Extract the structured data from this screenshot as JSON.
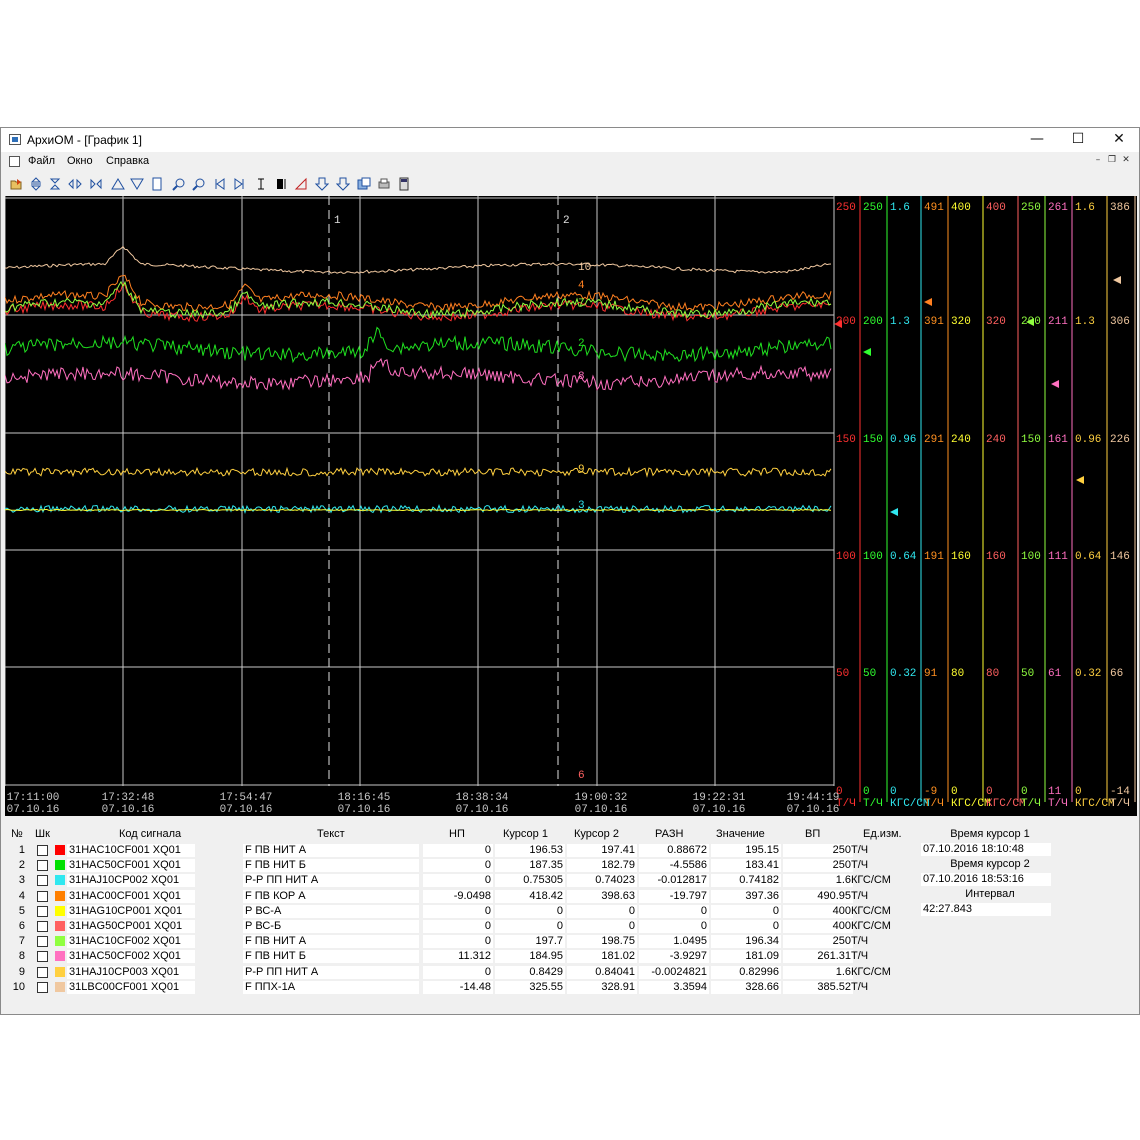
{
  "window": {
    "title": "АрхиОМ - [График 1]",
    "menu": [
      "Файл",
      "Окно",
      "Справка"
    ]
  },
  "toolbar_icons": [
    "open-icon",
    "expand-vertical-icon",
    "collapse-vertical-icon",
    "split-icon",
    "join-icon",
    "triangle-up-icon",
    "triangle-down-icon",
    "page-icon",
    "zoom-in-icon",
    "zoom-out-icon",
    "first-icon",
    "last-icon",
    "cursor-icon",
    "bracket-icon",
    "angle-icon",
    "arrow-down-icon",
    "arrow-down2-icon",
    "export-icon",
    "print-icon",
    "calculator-icon"
  ],
  "chart": {
    "cursor1_label": "1",
    "cursor2_label": "2",
    "time_ticks": [
      {
        "time": "17:11:00",
        "date": "07.10.16"
      },
      {
        "time": "17:32:48",
        "date": "07.10.16"
      },
      {
        "time": "17:54:47",
        "date": "07.10.16"
      },
      {
        "time": "18:16:45",
        "date": "07.10.16"
      },
      {
        "time": "18:38:34",
        "date": "07.10.16"
      },
      {
        "time": "19:00:32",
        "date": "07.10.16"
      },
      {
        "time": "19:22:31",
        "date": "07.10.16"
      },
      {
        "time": "19:44:19",
        "date": "07.10.16"
      }
    ],
    "scales": [
      {
        "color": "#ff3030",
        "labels": [
          "250",
          "200",
          "150",
          "100",
          "50",
          "0"
        ],
        "unit": "Т/Ч"
      },
      {
        "color": "#30ff30",
        "labels": [
          "250",
          "200",
          "150",
          "100",
          "50",
          "0"
        ],
        "unit": "Т/Ч"
      },
      {
        "color": "#30e8f0",
        "labels": [
          "1.6",
          "1.3",
          "0.96",
          "0.64",
          "0.32",
          "0"
        ],
        "unit": "КГС/СМ"
      },
      {
        "color": "#ff9020",
        "labels": [
          "491",
          "391",
          "291",
          "191",
          "91",
          "-9"
        ],
        "unit": "Т/Ч"
      },
      {
        "color": "#ffff30",
        "labels": [
          "400",
          "320",
          "240",
          "160",
          "80",
          "0"
        ],
        "unit": "КГС/СМ"
      },
      {
        "color": "#ff6060",
        "labels": [
          "400",
          "320",
          "240",
          "160",
          "80",
          "0"
        ],
        "unit": "КГС/СМ"
      },
      {
        "color": "#90ff40",
        "labels": [
          "250",
          "200",
          "150",
          "100",
          "50",
          "0"
        ],
        "unit": "Т/Ч"
      },
      {
        "color": "#ff70c0",
        "labels": [
          "261",
          "211",
          "161",
          "111",
          "61",
          "11"
        ],
        "unit": "Т/Ч"
      },
      {
        "color": "#ffd040",
        "labels": [
          "1.6",
          "1.3",
          "0.96",
          "0.64",
          "0.32",
          "0"
        ],
        "unit": "КГС/СМ"
      },
      {
        "color": "#f0c8a0",
        "labels": [
          "386",
          "306",
          "226",
          "146",
          "66",
          "-14"
        ],
        "unit": "Т/Ч"
      }
    ],
    "trace_labels": [
      "10",
      "4",
      "7",
      "2",
      "8",
      "9",
      "3",
      "6"
    ]
  },
  "table": {
    "headers": {
      "num": "№",
      "shk": "Шк",
      "code": "Код сигнала",
      "text": "Текст",
      "np": "НП",
      "c1": "Курсор 1",
      "c2": "Курсор 2",
      "diff": "РАЗН",
      "value": "Значение",
      "vp": "ВП",
      "unit": "Ед.изм."
    },
    "rows": [
      {
        "n": "1",
        "color": "#ff0000",
        "code": "31HAC10CF001 XQ01",
        "text": "F ПВ НИТ А",
        "np": "0",
        "c1": "196.53",
        "c2": "197.41",
        "diff": "0.88672",
        "value": "195.15",
        "vp": "250",
        "unit": "Т/Ч"
      },
      {
        "n": "2",
        "color": "#00e000",
        "code": "31HAC50CF001 XQ01",
        "text": "F ПВ НИТ Б",
        "np": "0",
        "c1": "187.35",
        "c2": "182.79",
        "diff": "-4.5586",
        "value": "183.41",
        "vp": "250",
        "unit": "Т/Ч"
      },
      {
        "n": "3",
        "color": "#30e8f0",
        "code": "31HAJ10CP002 XQ01",
        "text": "Р-Р ПП НИТ А",
        "np": "0",
        "c1": "0.75305",
        "c2": "0.74023",
        "diff": "-0.012817",
        "value": "0.74182",
        "vp": "1.6",
        "unit": "КГС/СМ"
      },
      {
        "n": "4",
        "color": "#ff8000",
        "code": "31HAC00CF001 XQ01",
        "text": "F ПВ КОР А",
        "np": "-9.0498",
        "c1": "418.42",
        "c2": "398.63",
        "diff": "-19.797",
        "value": "397.36",
        "vp": "490.95",
        "unit": "Т/Ч"
      },
      {
        "n": "5",
        "color": "#ffff00",
        "code": "31HAG10CP001 XQ01",
        "text": "Р ВС-А",
        "np": "0",
        "c1": "0",
        "c2": "0",
        "diff": "0",
        "value": "0",
        "vp": "400",
        "unit": "КГС/СМ"
      },
      {
        "n": "6",
        "color": "#ff6060",
        "code": "31HAG50CP001 XQ01",
        "text": "Р ВС-Б",
        "np": "0",
        "c1": "0",
        "c2": "0",
        "diff": "0",
        "value": "0",
        "vp": "400",
        "unit": "КГС/СМ"
      },
      {
        "n": "7",
        "color": "#90ff40",
        "code": "31HAC10CF002 XQ01",
        "text": "F ПВ НИТ А",
        "np": "0",
        "c1": "197.7",
        "c2": "198.75",
        "diff": "1.0495",
        "value": "196.34",
        "vp": "250",
        "unit": "Т/Ч"
      },
      {
        "n": "8",
        "color": "#ff70c0",
        "code": "31HAC50CF002 XQ01",
        "text": "F ПВ НИТ Б",
        "np": "11.312",
        "c1": "184.95",
        "c2": "181.02",
        "diff": "-3.9297",
        "value": "181.09",
        "vp": "261.31",
        "unit": "Т/Ч"
      },
      {
        "n": "9",
        "color": "#ffd040",
        "code": "31HAJ10CP003 XQ01",
        "text": "Р-Р ПП НИТ А",
        "np": "0",
        "c1": "0.8429",
        "c2": "0.84041",
        "diff": "-0.0024821",
        "value": "0.82996",
        "vp": "1.6",
        "unit": "КГС/СМ"
      },
      {
        "n": "10",
        "color": "#f0c8a0",
        "code": "31LBC00CF001 XQ01",
        "text": "F ППХ-1А",
        "np": "-14.48",
        "c1": "325.55",
        "c2": "328.91",
        "diff": "3.3594",
        "value": "328.66",
        "vp": "385.52",
        "unit": "Т/Ч"
      }
    ],
    "side": {
      "cursor1_label": "Время курсор 1",
      "cursor1_value": "07.10.2016 18:10:48",
      "cursor2_label": "Время курсор 2",
      "cursor2_value": "07.10.2016 18:53:16",
      "interval_label": "Интервал",
      "interval_value": "42:27.843"
    }
  }
}
